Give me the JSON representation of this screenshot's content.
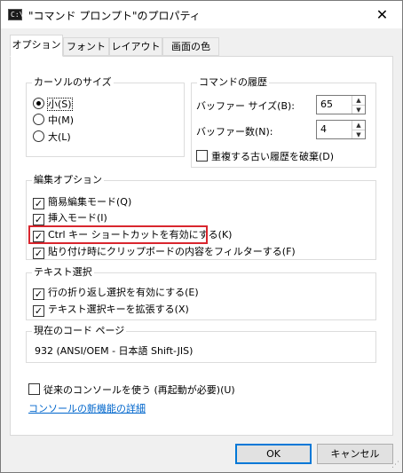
{
  "window": {
    "title": "\"コマンド プロンプト\"のプロパティ",
    "app_icon_text": "C:\\",
    "close_glyph": "✕"
  },
  "tabs": [
    {
      "label": "オプション",
      "active": true
    },
    {
      "label": "フォント",
      "active": false
    },
    {
      "label": "レイアウト",
      "active": false
    },
    {
      "label": "画面の色",
      "active": false
    }
  ],
  "cursor_size": {
    "title": "カーソルのサイズ",
    "options": [
      {
        "label": "小(S)",
        "selected": true
      },
      {
        "label": "中(M)",
        "selected": false
      },
      {
        "label": "大(L)",
        "selected": false
      }
    ]
  },
  "history": {
    "title": "コマンドの履歴",
    "buffer_size_label": "バッファー サイズ(B):",
    "buffer_size_value": "65",
    "buffer_count_label": "バッファー数(N):",
    "buffer_count_value": "4",
    "discard_duplicates_label": "重複する古い履歴を破棄(D)",
    "discard_duplicates_checked": false
  },
  "edit_options": {
    "title": "編集オプション",
    "items": [
      {
        "label": "簡易編集モード(Q)",
        "checked": true
      },
      {
        "label": "挿入モード(I)",
        "checked": true
      },
      {
        "label": "Ctrl キー ショートカットを有効にする(K)",
        "checked": true
      },
      {
        "label": "貼り付け時にクリップボードの内容をフィルターする(F)",
        "checked": true
      }
    ]
  },
  "text_selection": {
    "title": "テキスト選択",
    "items": [
      {
        "label": "行の折り返し選択を有効にする(E)",
        "checked": true
      },
      {
        "label": "テキスト選択キーを拡張する(X)",
        "checked": true
      }
    ]
  },
  "codepage": {
    "title": "現在のコード ページ",
    "value": "932   (ANSI/OEM - 日本語 Shift-JIS)"
  },
  "legacy_console": {
    "label": "従来のコンソールを使う (再起動が必要)(U)",
    "checked": false
  },
  "new_features_link": "コンソールの新機能の詳細",
  "buttons": {
    "ok": "OK",
    "cancel": "キャンセル"
  },
  "colors": {
    "highlight_border": "#d9262e",
    "link": "#0066cc",
    "default_button_border": "#0078d7"
  },
  "spin_up_glyph": "▲",
  "spin_down_glyph": "▼",
  "check_glyph": "✓",
  "grip_glyph": "⋰"
}
